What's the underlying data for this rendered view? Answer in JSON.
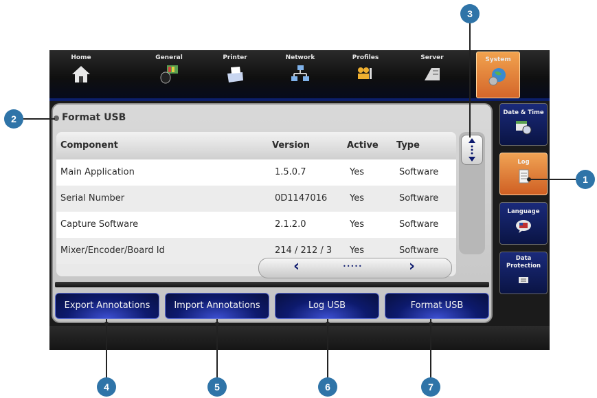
{
  "tabs": [
    {
      "label": "Home",
      "icon": "house-icon"
    },
    {
      "label": "General",
      "icon": "speaker-icon"
    },
    {
      "label": "Printer",
      "icon": "printer-icon"
    },
    {
      "label": "Network",
      "icon": "network-icon"
    },
    {
      "label": "Profiles",
      "icon": "profiles-icon"
    },
    {
      "label": "Server",
      "icon": "server-icon"
    },
    {
      "label": "System",
      "icon": "globe-icon",
      "active": true
    }
  ],
  "panel": {
    "title": "Format USB"
  },
  "table": {
    "headers": [
      "Component",
      "Version",
      "Active",
      "Type"
    ],
    "rows": [
      [
        "Main Application",
        "1.5.0.7",
        "Yes",
        "Software"
      ],
      [
        "Serial Number",
        "0D1147016",
        "Yes",
        "Software"
      ],
      [
        "Capture Software",
        "2.1.2.0",
        "Yes",
        "Software"
      ],
      [
        "Mixer/Encoder/Board Id",
        "214 / 212 / 3",
        "Yes",
        "Software"
      ]
    ]
  },
  "hscroll": {
    "left": "‹",
    "dots": "•••••",
    "right": "›"
  },
  "actions": [
    "Export Annotations",
    "Import Annotations",
    "Log USB",
    "Format USB"
  ],
  "side_buttons": [
    {
      "label": "Date & Time",
      "icon": "calendar-clock-icon"
    },
    {
      "label": "Log",
      "icon": "log-document-icon",
      "active": true
    },
    {
      "label": "Language",
      "icon": "speech-bubble-flag-icon"
    },
    {
      "label": "Data Protection",
      "icon": "shield-icon"
    }
  ],
  "callouts": [
    "1",
    "2",
    "3",
    "4",
    "5",
    "6",
    "7"
  ],
  "colors": {
    "accent_orange": "#e07a35",
    "button_blue": "#0d1a6e",
    "callout_blue": "#2f74a8"
  }
}
